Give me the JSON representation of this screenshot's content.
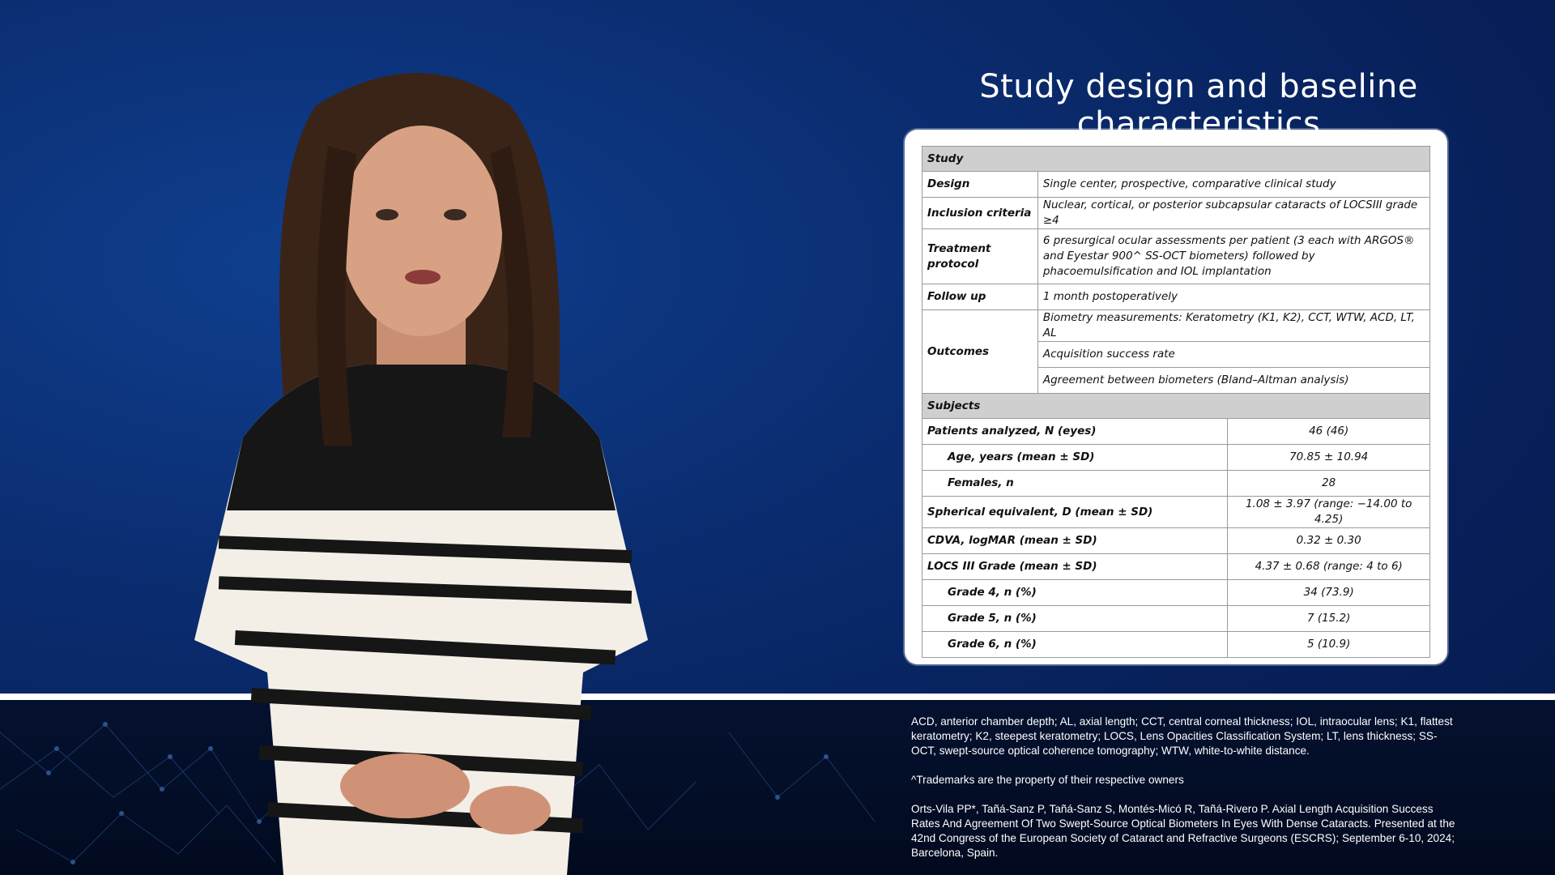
{
  "slide": {
    "title": "Study design and baseline characteristics"
  },
  "study_table": {
    "study_header": "Study",
    "design": {
      "label": "Design",
      "value": "Single center, prospective, comparative clinical study"
    },
    "inclusion": {
      "label": "Inclusion criteria",
      "value": "Nuclear, cortical, or posterior subcapsular cataracts of LOCSIII grade ≥4"
    },
    "treatment": {
      "label": "Treatment protocol",
      "value": "6 presurgical ocular assessments per patient (3 each with ARGOS® and Eyestar 900^ SS-OCT biometers) followed by phacoemulsification and IOL implantation"
    },
    "followup": {
      "label": "Follow up",
      "value": "1 month postoperatively"
    },
    "outcomes": {
      "label": "Outcomes",
      "values": [
        "Biometry measurements: Keratometry (K1, K2), CCT, WTW, ACD, LT, AL",
        "Acquisition success rate",
        "Agreement between biometers (Bland–Altman analysis)"
      ]
    },
    "subjects_header": "Subjects",
    "subjects": [
      {
        "label": "Patients analyzed, N (eyes)",
        "value": "46 (46)"
      },
      {
        "label": "Age, years (mean ± SD)",
        "value": "70.85 ± 10.94"
      },
      {
        "label": "Females, n",
        "value": "28"
      },
      {
        "label": "Spherical equivalent, D (mean ± SD)",
        "value": "1.08 ± 3.97 (range: −14.00 to 4.25)"
      },
      {
        "label": "CDVA, logMAR (mean ± SD)",
        "value": "0.32 ± 0.30"
      },
      {
        "label": "LOCS III Grade (mean ± SD)",
        "value": "4.37 ± 0.68 (range: 4 to 6)"
      },
      {
        "label": "Grade 4, n (%)",
        "value": "34 (73.9)"
      },
      {
        "label": "Grade 5, n (%)",
        "value": "7 (15.2)"
      },
      {
        "label": "Grade 6, n (%)",
        "value": "5 (10.9)"
      }
    ]
  },
  "footnotes": {
    "abbreviations": "ACD, anterior chamber depth; AL, axial length; CCT, central corneal thickness; IOL, intraocular lens; K1, flattest keratometry; K2, steepest keratometry; LOCS, Lens Opacities Classification System; LT, lens thickness; SS-OCT, swept-source optical coherence tomography; WTW, white-to-white distance.",
    "trademark": "^Trademarks are the property of their respective owners",
    "reference": "Orts-Vila PP*, Tañá-Sanz P, Tañá-Sanz S, Montés-Micó R, Tañá-Rivero P. Axial Length Acquisition Success Rates And Agreement Of Two Swept-Source Optical Biometers In Eyes With Dense Cataracts. Presented at the 42nd Congress of the European Society of Cataract and Refractive Surgeons (ESCRS); September 6-10, 2024; Barcelona, Spain."
  },
  "colors": {
    "background": "#0b2e72",
    "band": "#020a1f",
    "header_fill": "#cfcfcf"
  }
}
